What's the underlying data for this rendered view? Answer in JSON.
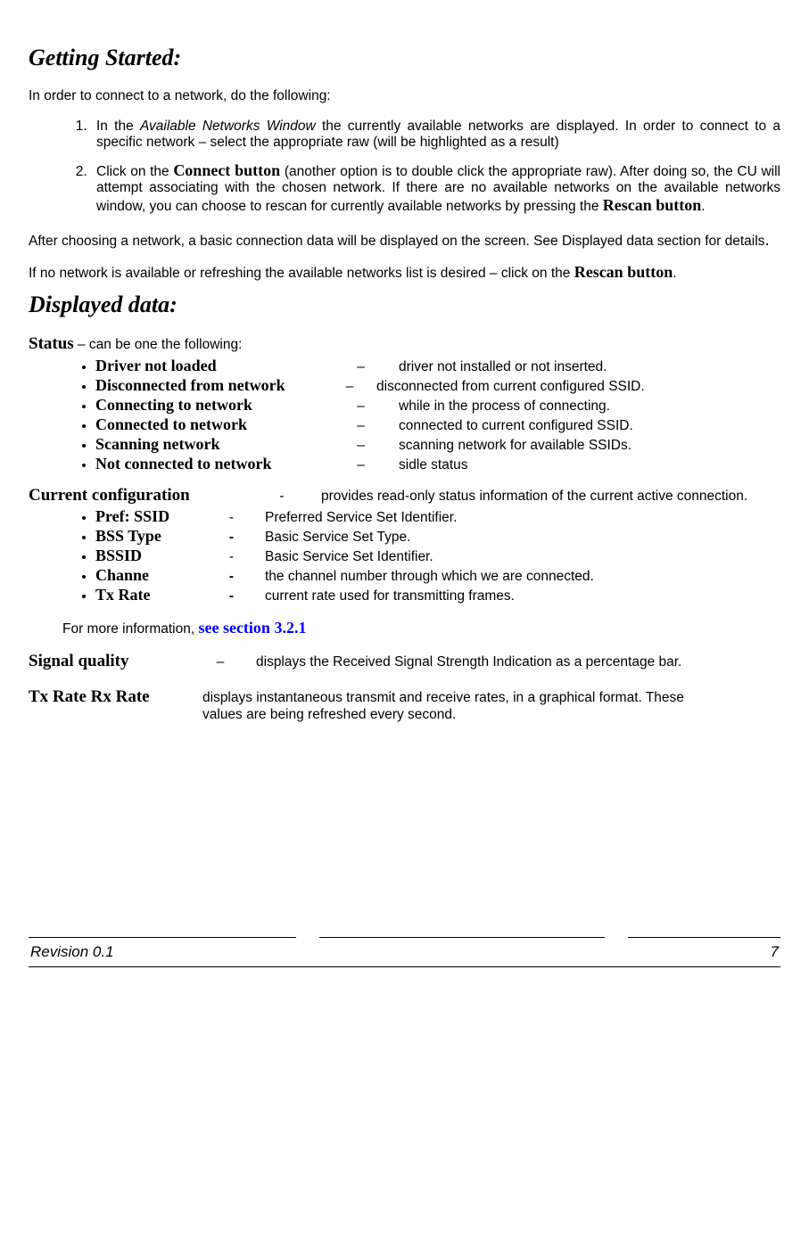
{
  "heading1": "Getting Started:",
  "intro": "In order to connect to a network, do the following:",
  "step1_a": "In the ",
  "step1_b": "Available Networks Window",
  "step1_c": " the currently available networks are displayed. In order to connect to a specific network – select the appropriate raw (will be highlighted as a result)",
  "step2_a": "Click on the ",
  "step2_b": "Connect button",
  "step2_c": " (another option is to double click the appropriate raw). After doing so, the CU will attempt associating with the chosen network. If there are no available networks on the available networks window, you can choose to rescan for currently available networks by pressing the ",
  "step2_d": "Rescan button",
  "step2_e": ".",
  "after1": "After choosing a network, a basic connection data will be displayed on the screen. See Displayed data section for details",
  "after1_dot": ".",
  "after2_a": "If no network is available or refreshing the available networks list is desired – click on the ",
  "after2_b": "Rescan button",
  "after2_c": ".",
  "heading2": "Displayed data:",
  "status_label": "Status",
  "status_intro": " – can be one the following:",
  "status_items": [
    {
      "term": "Driver not loaded",
      "dash": "–",
      "desc": "driver not installed or not inserted."
    },
    {
      "term": "Disconnected from network",
      "dash": "–",
      "desc": "disconnected from current configured SSID."
    },
    {
      "term": "Connecting to network",
      "dash": "–",
      "desc": " while in the process of connecting."
    },
    {
      "term": "Connected to network",
      "dash": "–",
      "desc": "connected to current configured SSID."
    },
    {
      "term": "Scanning network",
      "dash": "–",
      "desc": "scanning network for available SSIDs."
    },
    {
      "term": "Not connected to network",
      "dash": "–",
      "desc": "sidle status"
    }
  ],
  "cfg_label": "Current configuration",
  "cfg_dash": "-",
  "cfg_desc": "provides read-only status information of the current active connection.",
  "cfg_items": [
    {
      "term": "Pref: SSID",
      "dash": "-",
      "bold": false,
      "desc": "Preferred Service Set Identifier."
    },
    {
      "term": "BSS Type",
      "dash": "-",
      "bold": true,
      "desc": "Basic Service Set Type."
    },
    {
      "term": "BSSID",
      "dash": "-",
      "bold": false,
      "desc": "Basic Service Set Identifier."
    },
    {
      "term": "Channe",
      "dash": "-",
      "bold": true,
      "desc": "the channel number through which we are connected."
    },
    {
      "term": "Tx Rate",
      "dash": "-",
      "bold": true,
      "desc": "current rate used for transmitting frames."
    }
  ],
  "more_info_a": "For more information, ",
  "more_info_b": "see section 3.2.1",
  "sq_label": "Signal quality",
  "sq_dash": "–",
  "sq_desc": "displays the Received Signal Strength Indication as a percentage bar.",
  "txrx_label": "Tx Rate Rx Rate",
  "txrx_desc1": "displays instantaneous transmit and receive rates, in a graphical format. These",
  "txrx_desc2": "values are being refreshed every second.",
  "footer_rev": "Revision 0.1",
  "footer_page": "7"
}
